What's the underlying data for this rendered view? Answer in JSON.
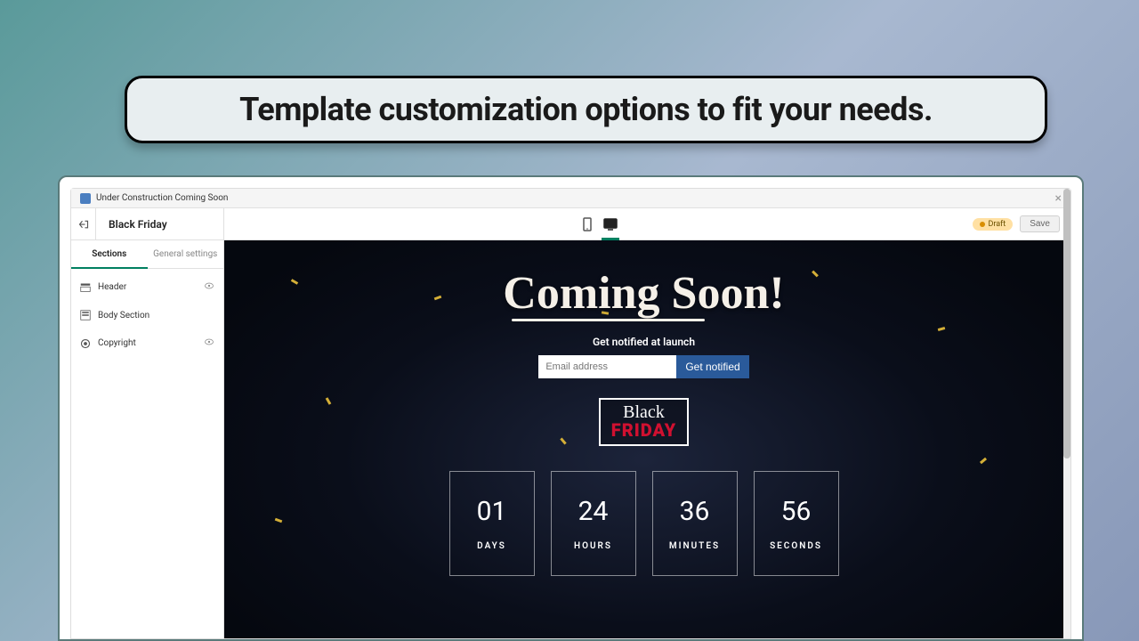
{
  "banner": {
    "title": "Template customization options to fit your needs."
  },
  "titlebar": {
    "app_name": "Under Construction Coming Soon"
  },
  "toolbar": {
    "template_name": "Black Friday",
    "draft_label": "Draft",
    "save_label": "Save"
  },
  "sidebar": {
    "tabs": [
      {
        "label": "Sections",
        "active": true
      },
      {
        "label": "General settings",
        "active": false
      }
    ],
    "sections": [
      {
        "label": "Header",
        "has_visibility": true
      },
      {
        "label": "Body Section",
        "has_visibility": false
      },
      {
        "label": "Copyright",
        "has_visibility": true
      }
    ]
  },
  "preview": {
    "heading": "Coming Soon!",
    "notify_label": "Get notified at launch",
    "email_placeholder": "Email address",
    "notify_button": "Get notified",
    "logo_top": "Black",
    "logo_bottom": "FRIDAY",
    "countdown": [
      {
        "value": "01",
        "label": "DAYS"
      },
      {
        "value": "24",
        "label": "HOURS"
      },
      {
        "value": "36",
        "label": "MINUTES"
      },
      {
        "value": "56",
        "label": "SECONDS"
      }
    ]
  }
}
